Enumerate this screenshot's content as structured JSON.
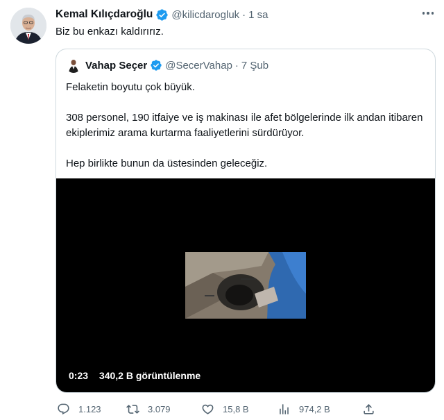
{
  "tweet": {
    "author_name": "Kemal Kılıçdaroğlu",
    "handle": "@kilicdarogluk",
    "separator": "·",
    "time": "1 sa",
    "text": "Biz bu enkazı kaldırırız."
  },
  "quote": {
    "author_name": "Vahap Seçer",
    "handle": "@SecerVahap",
    "separator": "·",
    "time": "7 Şub",
    "paragraphs": [
      "Felaketin boyutu çok büyük.",
      "308 personel, 190 itfaiye ve iş makinası ile afet bölgelerinde ilk andan itibaren ekiplerimiz arama kurtarma faaliyetlerini sürdürüyor.",
      "Hep birlikte bunun da üstesinden geleceğiz."
    ],
    "video": {
      "duration": "0:23",
      "views": "340,2 B görüntülenme"
    }
  },
  "actions": {
    "replies": "1.123",
    "retweets": "3.079",
    "likes": "15,8 B",
    "views": "974,2 B"
  },
  "icons": {
    "verified": "verified-badge-icon",
    "more": "more-icon",
    "reply": "reply-icon",
    "retweet": "retweet-icon",
    "like": "heart-icon",
    "views": "analytics-icon",
    "share": "share-icon"
  },
  "colors": {
    "verified_blue": "#1d9bf0",
    "secondary_text": "#536471",
    "border": "#cfd9de",
    "video_bg": "#000000"
  }
}
